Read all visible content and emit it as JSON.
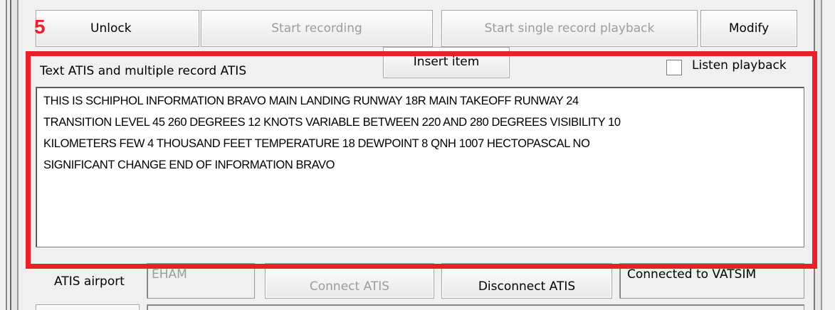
{
  "toolbar": {
    "step": "5",
    "unlock": "Unlock",
    "start_recording": "Start recording",
    "start_playback": "Start single record playback",
    "modify": "Modify"
  },
  "atis": {
    "insert_item": "Insert item",
    "section_label": "Text ATIS and multiple record ATIS",
    "listen_playback": "Listen playback",
    "text": "THIS IS SCHIPHOL INFORMATION BRAVO MAIN LANDING RUNWAY 18R MAIN TAKEOFF RUNWAY 24\nTRANSITION LEVEL 45 260 DEGREES 12 KNOTS VARIABLE BETWEEN 220 AND 280 DEGREES VISIBILITY 10\nKILOMETERS FEW 4 THOUSAND FEET TEMPERATURE 18 DEWPOINT 8 QNH 1007 HECTOPASCAL NO\nSIGNIFICANT CHANGE END OF INFORMATION BRAVO"
  },
  "bottom": {
    "airport_label": "ATIS airport",
    "airport_value": "EHAM",
    "connect": "Connect ATIS",
    "disconnect": "Disconnect ATIS",
    "status": "Connected to VATSIM"
  },
  "colors": {
    "highlight": "#e8202a"
  }
}
